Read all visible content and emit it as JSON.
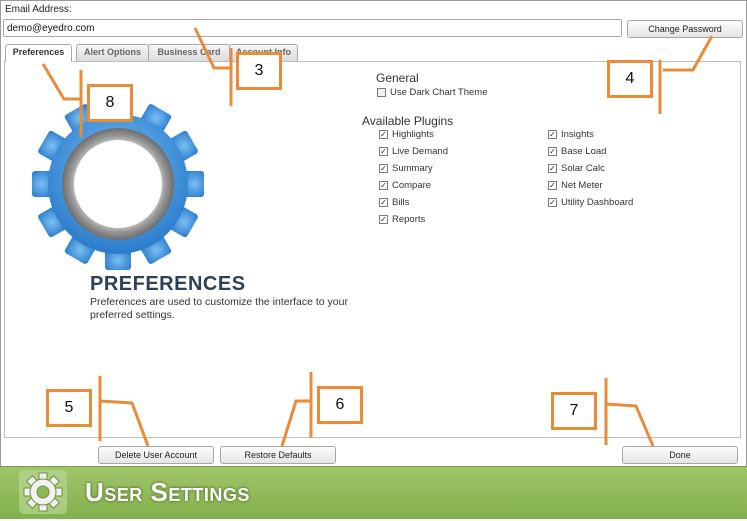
{
  "email": {
    "label": "Email Address:",
    "value": "demo@eyedro.com"
  },
  "buttons": {
    "change_password": "Change Password",
    "delete_account": "Delete User Account",
    "restore_defaults": "Restore Defaults",
    "done": "Done"
  },
  "tabs": [
    {
      "label": "Preferences",
      "active": true
    },
    {
      "label": "Alert Options",
      "active": false
    },
    {
      "label": "Business Card",
      "active": false
    },
    {
      "label": "Account Info",
      "active": false
    }
  ],
  "preferences": {
    "heading": "PREFERENCES",
    "description": "Preferences are used to customize the interface to your preferred settings.",
    "icon": "gear-icon"
  },
  "general": {
    "heading": "General",
    "options": [
      {
        "label": "Use Dark Chart Theme",
        "checked": false
      }
    ]
  },
  "plugins": {
    "heading": "Available Plugins",
    "left": [
      {
        "label": "Highlights",
        "checked": true
      },
      {
        "label": "Live Demand",
        "checked": true
      },
      {
        "label": "Summary",
        "checked": true
      },
      {
        "label": "Compare",
        "checked": true
      },
      {
        "label": "Bills",
        "checked": true
      },
      {
        "label": "Reports",
        "checked": true
      }
    ],
    "right": [
      {
        "label": "Insights",
        "checked": true
      },
      {
        "label": "Base Load",
        "checked": true
      },
      {
        "label": "Solar Calc",
        "checked": true
      },
      {
        "label": "Net Meter",
        "checked": true
      },
      {
        "label": "Utility Dashboard",
        "checked": true
      }
    ]
  },
  "annotations": [
    "3",
    "4",
    "5",
    "6",
    "7",
    "8"
  ],
  "footer": {
    "title": "User Settings",
    "icon": "gear-icon"
  },
  "colors": {
    "annotation": "#e98c39",
    "footer_green": "#8fb957",
    "gear_blue": "#3a8fd6",
    "title_navy": "#2f3f5a"
  }
}
